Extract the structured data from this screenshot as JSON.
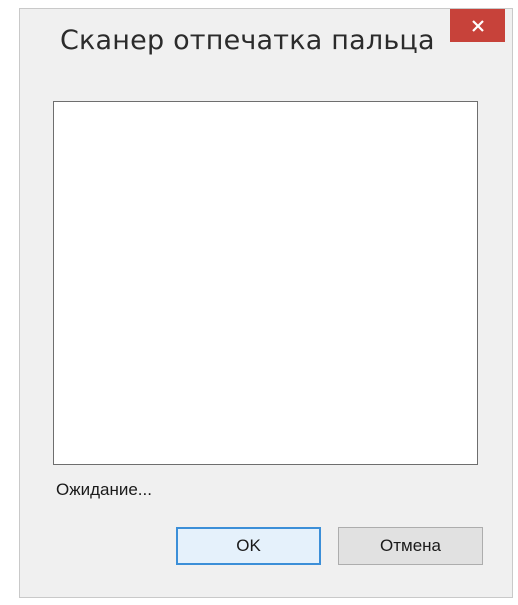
{
  "window": {
    "title": "Сканер отпечатка пальца"
  },
  "titlebar": {
    "close_icon": "close-icon",
    "close_color": "#c7423a"
  },
  "scanner": {
    "status": "Ожидание..."
  },
  "buttons": {
    "ok_label": "OK",
    "cancel_label": "Отмена",
    "ok_focus_color": "#3c8fd8"
  }
}
